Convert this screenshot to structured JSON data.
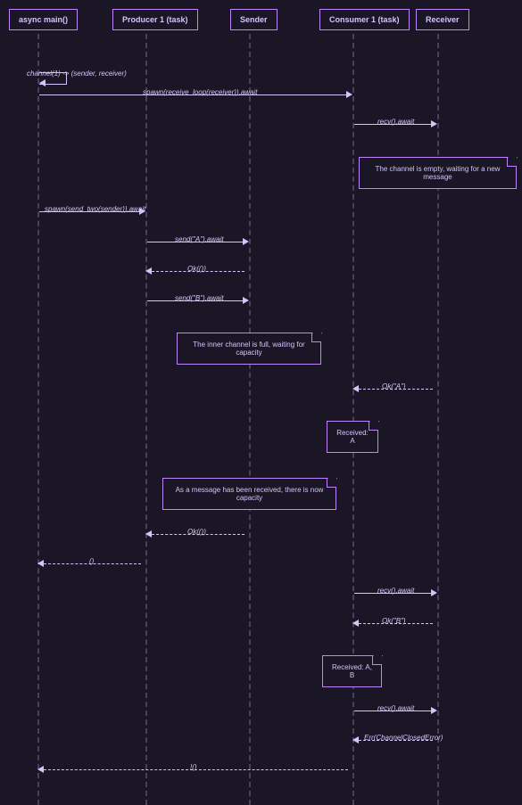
{
  "participants": {
    "main": "async main()",
    "producer": "Producer 1 (task)",
    "sender": "Sender",
    "consumer": "Consumer 1 (task)",
    "receiver": "Receiver"
  },
  "messages": {
    "channel_create": "channel(1) -> (sender, receiver)",
    "spawn_consumer": "spawn(receive_loop(receiver)).await",
    "recv1": "recv().await",
    "note_empty": "The channel is empty, waiting for a new message",
    "spawn_producer": "spawn(send_two(sender)).await",
    "send_a": "send(\"A\").await",
    "ok_unit1": "Ok(())",
    "send_b": "send(\"B\").await",
    "note_full": "The inner channel is full, waiting for capacity",
    "ok_a": "Ok(\"A\")",
    "note_recv_a": "Received: A",
    "note_capacity": "As a message has been received, there is now capacity",
    "ok_unit2": "Ok(())",
    "ret_unit": "()",
    "recv2": "recv().await",
    "ok_b": "Ok(\"B\")",
    "note_recv_ab": "Received: A, B",
    "recv3": "recv().await",
    "err_closed": "Err(ChannelClosedError)",
    "ret_excl": "!()"
  }
}
